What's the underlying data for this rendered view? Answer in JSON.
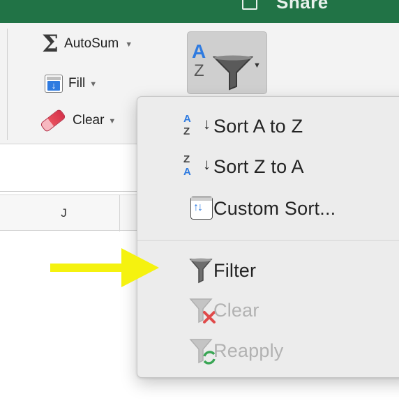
{
  "titlebar": {
    "share_label": "Share",
    "share_icon": "share-icon",
    "brand_color": "#217346"
  },
  "ribbon": {
    "autosum_label": "AutoSum",
    "autosum_icon": "sigma-icon",
    "fill_label": "Fill",
    "fill_icon": "fill-down-icon",
    "clear_label": "Clear",
    "clear_icon": "eraser-icon",
    "sort_filter_icon": "sort-filter-icon",
    "sort_a": "A",
    "sort_z": "Z"
  },
  "grid": {
    "column_header": "J"
  },
  "menu": {
    "items": [
      {
        "label": "Sort A to Z",
        "icon": "sort-ascending-icon",
        "icon_top": "A",
        "icon_bottom": "Z",
        "enabled": true
      },
      {
        "label": "Sort Z to A",
        "icon": "sort-descending-icon",
        "icon_top": "Z",
        "icon_bottom": "A",
        "enabled": true
      },
      {
        "label": "Custom Sort...",
        "icon": "custom-sort-icon",
        "enabled": true
      },
      {
        "label": "Filter",
        "icon": "filter-icon",
        "enabled": true
      },
      {
        "label": "Clear",
        "icon": "clear-filter-icon",
        "enabled": false
      },
      {
        "label": "Reapply",
        "icon": "reapply-filter-icon",
        "enabled": false
      }
    ]
  },
  "annotation": {
    "arrow_icon": "pointer-arrow-icon",
    "arrow_color": "#f5f20f"
  },
  "colors": {
    "accent_blue": "#2f7be0",
    "disabled_text": "#b2b2b2",
    "clear_red": "#e04a4a",
    "reapply_green": "#3aa655"
  }
}
